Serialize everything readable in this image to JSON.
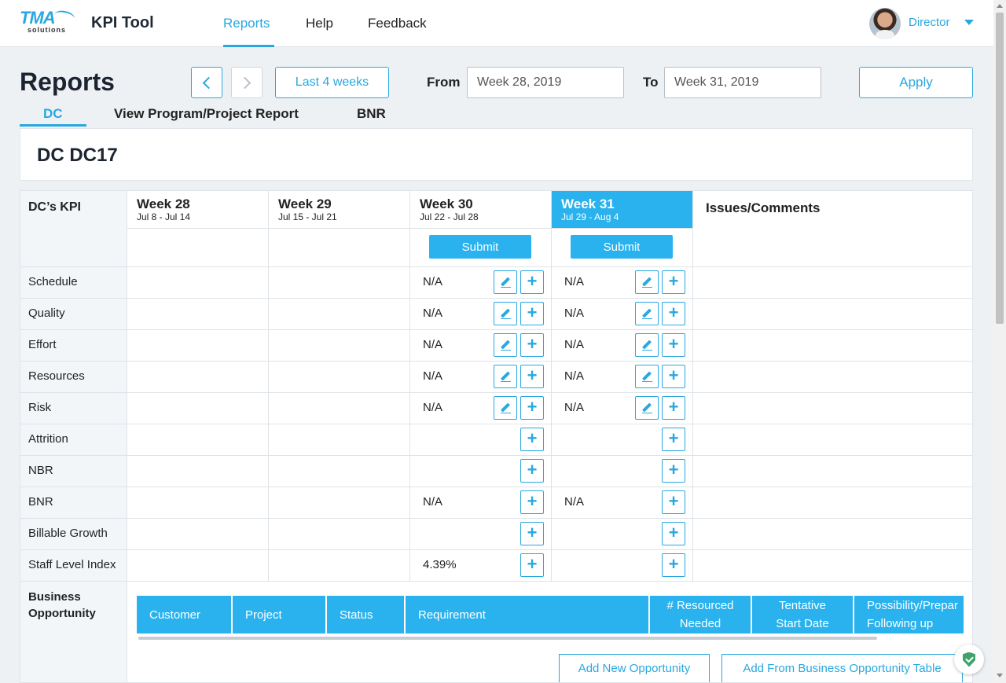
{
  "app": {
    "logo_main": "TMA",
    "logo_sub": "solutions",
    "title": "KPI Tool"
  },
  "nav": {
    "items": [
      "Reports",
      "Help",
      "Feedback"
    ],
    "active": "Reports"
  },
  "user": {
    "role": "Director"
  },
  "page": {
    "title": "Reports"
  },
  "controls": {
    "range_button": "Last 4 weeks",
    "from_label": "From",
    "from_value": "Week 28, 2019",
    "to_label": "To",
    "to_value": "Week 31, 2019",
    "apply_label": "Apply"
  },
  "tabs": [
    "DC",
    "View Program/Project Report",
    "BNR"
  ],
  "dc": {
    "title": "DC DC17"
  },
  "grid": {
    "kpi_header": "DC’s KPI",
    "issues_header": "Issues/Comments",
    "submit_label": "Submit",
    "weeks": [
      {
        "title": "Week 28",
        "range": "Jul 8 - Jul 14"
      },
      {
        "title": "Week 29",
        "range": "Jul 15 - Jul 21"
      },
      {
        "title": "Week 30",
        "range": "Jul 22 - Jul 28"
      },
      {
        "title": "Week 31",
        "range": "Jul 29 - Aug 4"
      }
    ],
    "rows": [
      {
        "label": "Schedule",
        "w30": "N/A",
        "w31": "N/A",
        "editable": true
      },
      {
        "label": "Quality",
        "w30": "N/A",
        "w31": "N/A",
        "editable": true
      },
      {
        "label": "Effort",
        "w30": "N/A",
        "w31": "N/A",
        "editable": true
      },
      {
        "label": "Resources",
        "w30": "N/A",
        "w31": "N/A",
        "editable": true
      },
      {
        "label": "Risk",
        "w30": "N/A",
        "w31": "N/A",
        "editable": true
      },
      {
        "label": "Attrition",
        "w30": "",
        "w31": "",
        "editable": false
      },
      {
        "label": "NBR",
        "w30": "",
        "w31": "",
        "editable": false
      },
      {
        "label": "BNR",
        "w30": "N/A",
        "w31": "N/A",
        "editable": false
      },
      {
        "label": "Billable Growth",
        "w30": "",
        "w31": "",
        "editable": false
      },
      {
        "label": "Staff Level Index",
        "w30": "4.39%",
        "w31": "",
        "editable": false
      }
    ]
  },
  "business_opportunity": {
    "label": "Business Opportunity",
    "columns": [
      "Customer",
      "Project",
      "Status",
      "Requirement",
      "# Resourced Needed",
      "Tentative Start Date",
      "Possibility/Prepar Following up"
    ],
    "add_new": "Add New Opportunity",
    "add_from_table": "Add From Business Opportunity Table"
  },
  "colors": {
    "accent": "#29a8e0",
    "header_fill": "#29b2ee",
    "page_bg": "#eef1f4"
  },
  "icons": [
    "chevron-left-icon",
    "chevron-right-icon",
    "caret-down-icon",
    "edit-pencil-icon",
    "plus-icon",
    "shield-check-icon"
  ]
}
